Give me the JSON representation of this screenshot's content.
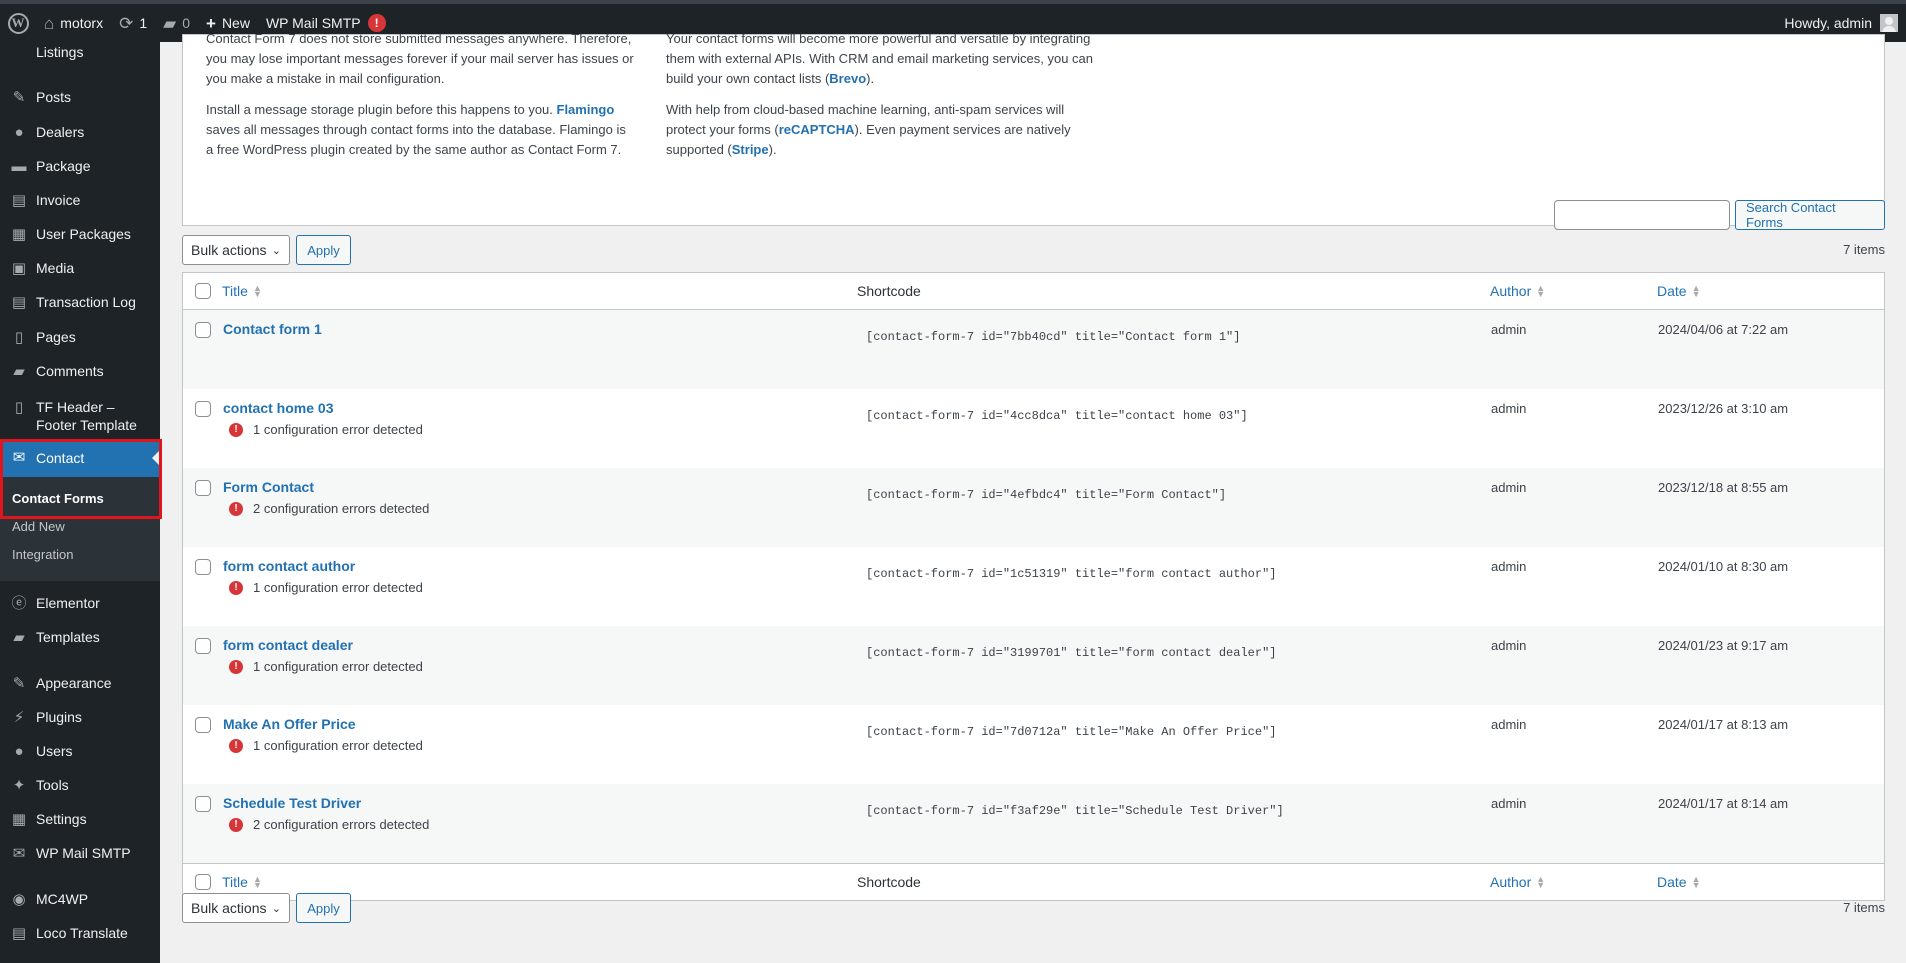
{
  "adminbar": {
    "site_name": "motorx",
    "updates_count": "1",
    "comments_count": "0",
    "new_label": "New",
    "smtp_label": "WP Mail SMTP",
    "smtp_badge": "!",
    "howdy": "Howdy, admin"
  },
  "sidebar": {
    "items": [
      {
        "label": "Listings",
        "icon": "list-icon"
      },
      {
        "label": "Posts",
        "icon": "pin-icon"
      },
      {
        "label": "Dealers",
        "icon": "user-icon"
      },
      {
        "label": "Package",
        "icon": "package-icon"
      },
      {
        "label": "Invoice",
        "icon": "invoice-icon"
      },
      {
        "label": "User Packages",
        "icon": "packages-icon"
      },
      {
        "label": "Media",
        "icon": "media-icon"
      },
      {
        "label": "Transaction Log",
        "icon": "log-icon"
      },
      {
        "label": "Pages",
        "icon": "pages-icon"
      },
      {
        "label": "Comments",
        "icon": "comments-icon"
      },
      {
        "label": "TF Header – Footer Template",
        "icon": "template-icon"
      },
      {
        "label": "Contact",
        "icon": "mail-icon"
      },
      {
        "label": "Elementor",
        "icon": "elementor-icon"
      },
      {
        "label": "Templates",
        "icon": "folder-icon"
      },
      {
        "label": "Appearance",
        "icon": "brush-icon"
      },
      {
        "label": "Plugins",
        "icon": "plugin-icon"
      },
      {
        "label": "Users",
        "icon": "users-icon"
      },
      {
        "label": "Tools",
        "icon": "wrench-icon"
      },
      {
        "label": "Settings",
        "icon": "settings-icon"
      },
      {
        "label": "WP Mail SMTP",
        "icon": "smtp-icon"
      },
      {
        "label": "MC4WP",
        "icon": "mc4wp-icon"
      },
      {
        "label": "Loco Translate",
        "icon": "translate-icon"
      }
    ],
    "submenu": {
      "current": "Contact Forms",
      "items": [
        "Add New",
        "Integration"
      ]
    }
  },
  "promo": {
    "left_p1": "Contact Form 7 does not store submitted messages anywhere. Therefore, you may lose important messages forever if your mail server has issues or you make a mistake in mail configuration.",
    "left_p2_a": "Install a message storage plugin before this happens to you. ",
    "left_p2_link": "Flamingo",
    "left_p2_b": " saves all messages through contact forms into the database. Flamingo is a free WordPress plugin created by the same author as Contact Form 7.",
    "right_p1_a": "Your contact forms will become more powerful and versatile by integrating them with external APIs. With CRM and email marketing services, you can build your own contact lists (",
    "right_p1_link": "Brevo",
    "right_p1_b": ").",
    "right_p2_a": "With help from cloud-based machine learning, anti-spam services will protect your forms (",
    "right_p2_link1": "reCAPTCHA",
    "right_p2_b": "). Even payment services are natively supported (",
    "right_p2_link2": "Stripe",
    "right_p2_c": ")."
  },
  "search": {
    "placeholder": "",
    "button": "Search Contact Forms"
  },
  "bulk": {
    "select_label": "Bulk actions",
    "apply_label": "Apply",
    "items_count": "7 items"
  },
  "table": {
    "headers": {
      "title": "Title",
      "shortcode": "Shortcode",
      "author": "Author",
      "date": "Date"
    },
    "rows": [
      {
        "title": "Contact form 1",
        "error": "",
        "shortcode": "[contact-form-7 id=\"7bb40cd\" title=\"Contact form 1\"]",
        "author": "admin",
        "date": "2024/04/06 at 7:22 am"
      },
      {
        "title": "contact home 03",
        "error": "1 configuration error detected",
        "shortcode": "[contact-form-7 id=\"4cc8dca\" title=\"contact home 03\"]",
        "author": "admin",
        "date": "2023/12/26 at 3:10 am"
      },
      {
        "title": "Form Contact",
        "error": "2 configuration errors detected",
        "shortcode": "[contact-form-7 id=\"4efbdc4\" title=\"Form Contact\"]",
        "author": "admin",
        "date": "2023/12/18 at 8:55 am"
      },
      {
        "title": "form contact author",
        "error": "1 configuration error detected",
        "shortcode": "[contact-form-7 id=\"1c51319\" title=\"form contact author\"]",
        "author": "admin",
        "date": "2024/01/10 at 8:30 am"
      },
      {
        "title": "form contact dealer",
        "error": "1 configuration error detected",
        "shortcode": "[contact-form-7 id=\"3199701\" title=\"form contact dealer\"]",
        "author": "admin",
        "date": "2024/01/23 at 9:17 am"
      },
      {
        "title": "Make An Offer Price",
        "error": "1 configuration error detected",
        "shortcode": "[contact-form-7 id=\"7d0712a\" title=\"Make An Offer Price\"]",
        "author": "admin",
        "date": "2024/01/17 at 8:13 am"
      },
      {
        "title": "Schedule Test Driver",
        "error": "2 configuration errors detected",
        "shortcode": "[contact-form-7 id=\"f3af29e\" title=\"Schedule Test Driver\"]",
        "author": "admin",
        "date": "2024/01/17 at 8:14 am"
      }
    ]
  },
  "colors": {
    "adminbar_bg": "#1d2327",
    "accent": "#2271b1",
    "error": "#d63638",
    "highlight_border": "#e0161c"
  }
}
